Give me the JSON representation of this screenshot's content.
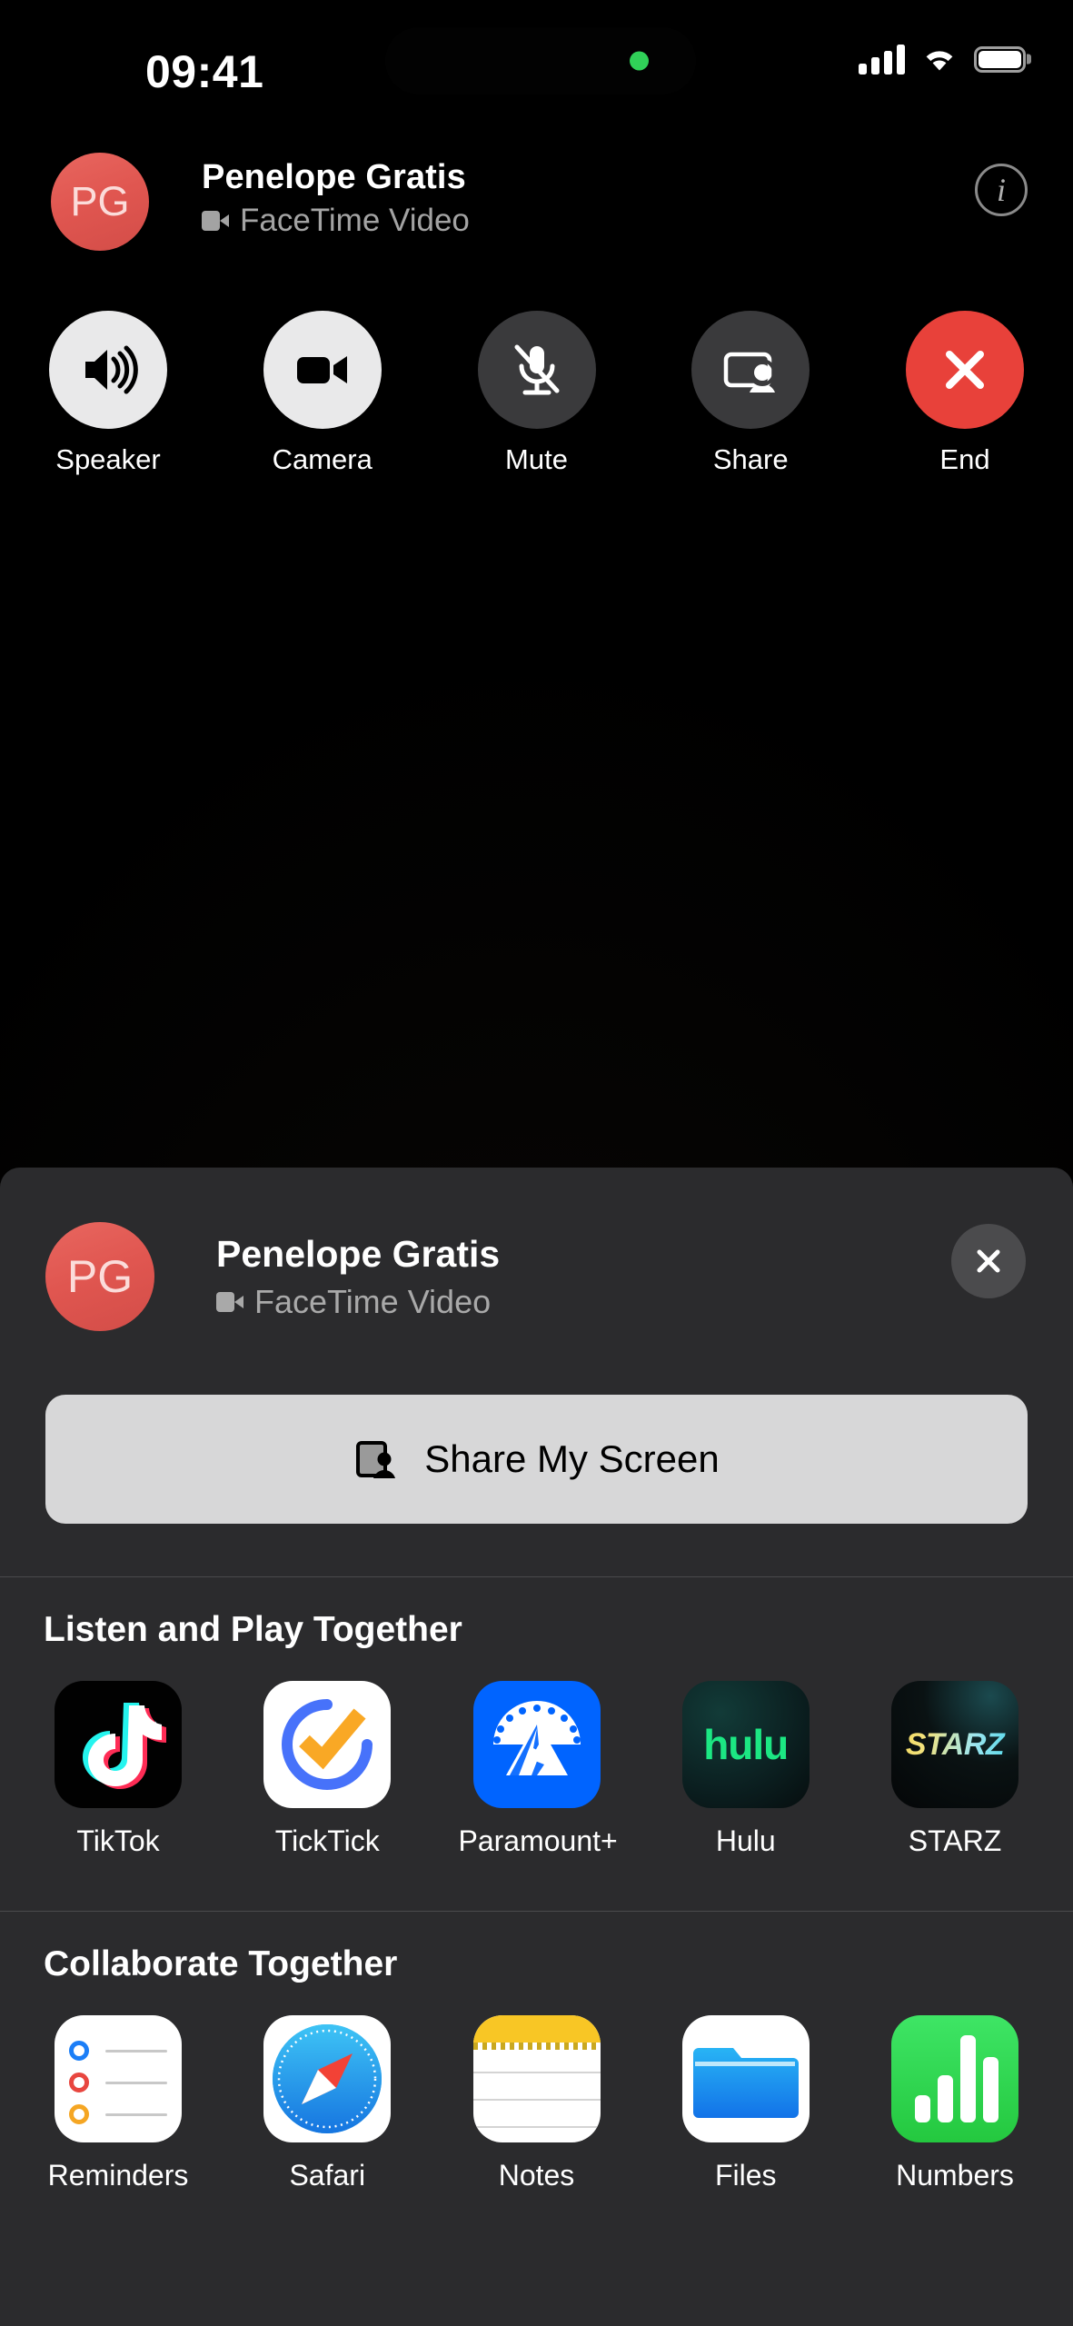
{
  "status_bar": {
    "time": "09:41",
    "cellular_icon": "cellular-bars-icon",
    "wifi_icon": "wifi-icon",
    "battery_icon": "battery-full-icon",
    "island_indicator": "camera-active-green-dot"
  },
  "call": {
    "avatar_initials": "PG",
    "avatar_color": "#e05650",
    "caller_name": "Penelope Gratis",
    "call_type": "FaceTime Video",
    "call_type_icon": "video-camera-icon",
    "info_button_label": "i",
    "controls": [
      {
        "label": "Speaker",
        "icon": "speaker-waves-icon",
        "state": "active"
      },
      {
        "label": "Camera",
        "icon": "video-camera-icon",
        "state": "active"
      },
      {
        "label": "Mute",
        "icon": "microphone-slash-icon",
        "state": "inactive"
      },
      {
        "label": "Share",
        "icon": "screen-share-person-icon",
        "state": "inactive"
      },
      {
        "label": "End",
        "icon": "close-x-icon",
        "state": "destructive"
      }
    ]
  },
  "sheet": {
    "avatar_initials": "PG",
    "caller_name": "Penelope Gratis",
    "call_type": "FaceTime Video",
    "close_icon": "close-x-icon",
    "share_button": {
      "label": "Share My Screen",
      "icon": "screen-share-person-icon"
    },
    "sections": [
      {
        "title": "Listen and Play Together",
        "apps": [
          {
            "label": "TikTok",
            "icon": "tiktok-app-icon"
          },
          {
            "label": "TickTick",
            "icon": "ticktick-app-icon"
          },
          {
            "label": "Paramount+",
            "icon": "paramount-plus-app-icon"
          },
          {
            "label": "Hulu",
            "icon": "hulu-app-icon"
          },
          {
            "label": "STARZ",
            "icon": "starz-app-icon"
          }
        ]
      },
      {
        "title": "Collaborate Together",
        "apps": [
          {
            "label": "Reminders",
            "icon": "reminders-app-icon"
          },
          {
            "label": "Safari",
            "icon": "safari-app-icon"
          },
          {
            "label": "Notes",
            "icon": "notes-app-icon"
          },
          {
            "label": "Files",
            "icon": "files-app-icon"
          },
          {
            "label": "Numbers",
            "icon": "numbers-app-icon"
          }
        ]
      }
    ]
  },
  "brand_text": {
    "hulu": "hulu",
    "starz": "STARZ"
  }
}
